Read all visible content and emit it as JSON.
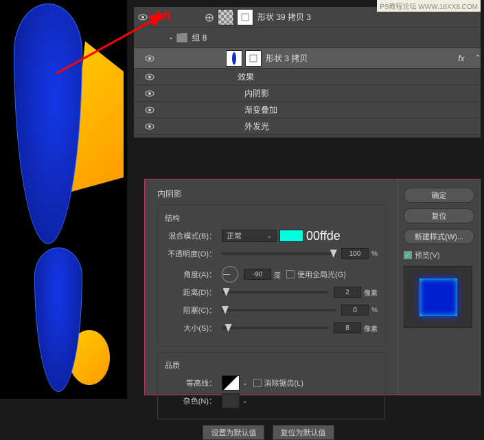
{
  "watermark": "PS教程论坛 WWW.16XX8.COM",
  "annotation": "Alt",
  "layers": {
    "row1": {
      "name": "形状 39 拷贝 3",
      "linked": "⚙"
    },
    "group": {
      "name": "组 8"
    },
    "row2": {
      "name": "形状 3 拷贝",
      "fx": "fx"
    },
    "effects_label": "效果",
    "effects": [
      "内阴影",
      "渐变叠加",
      "外发光"
    ]
  },
  "dialog": {
    "title": "内阴影",
    "struct_label": "结构",
    "blend_mode_label": "混合模式(B)：",
    "blend_mode_value": "正常",
    "swatch_color": "#00ffde",
    "swatch_label": "00ffde",
    "opacity_label": "不透明度(O)：",
    "opacity_value": "100",
    "percent": "%",
    "angle_label": "角度(A)：",
    "angle_value": "-90",
    "angle_unit": "度",
    "global_light": "使用全局光(G)",
    "distance_label": "距离(D)：",
    "distance_value": "2",
    "px": "像素",
    "choke_label": "阻塞(C)：",
    "choke_value": "0",
    "size_label": "大小(S)：",
    "size_value": "8",
    "quality_label": "品质",
    "contour_label": "等高线：",
    "antialias": "消除锯齿(L)",
    "noise_label": "杂色(N)：",
    "default_btn": "设置为默认值",
    "reset_btn": "复位为默认值",
    "ok": "确定",
    "cancel": "复位",
    "newstyle": "新建样式(W)...",
    "preview": "预览(V)"
  }
}
